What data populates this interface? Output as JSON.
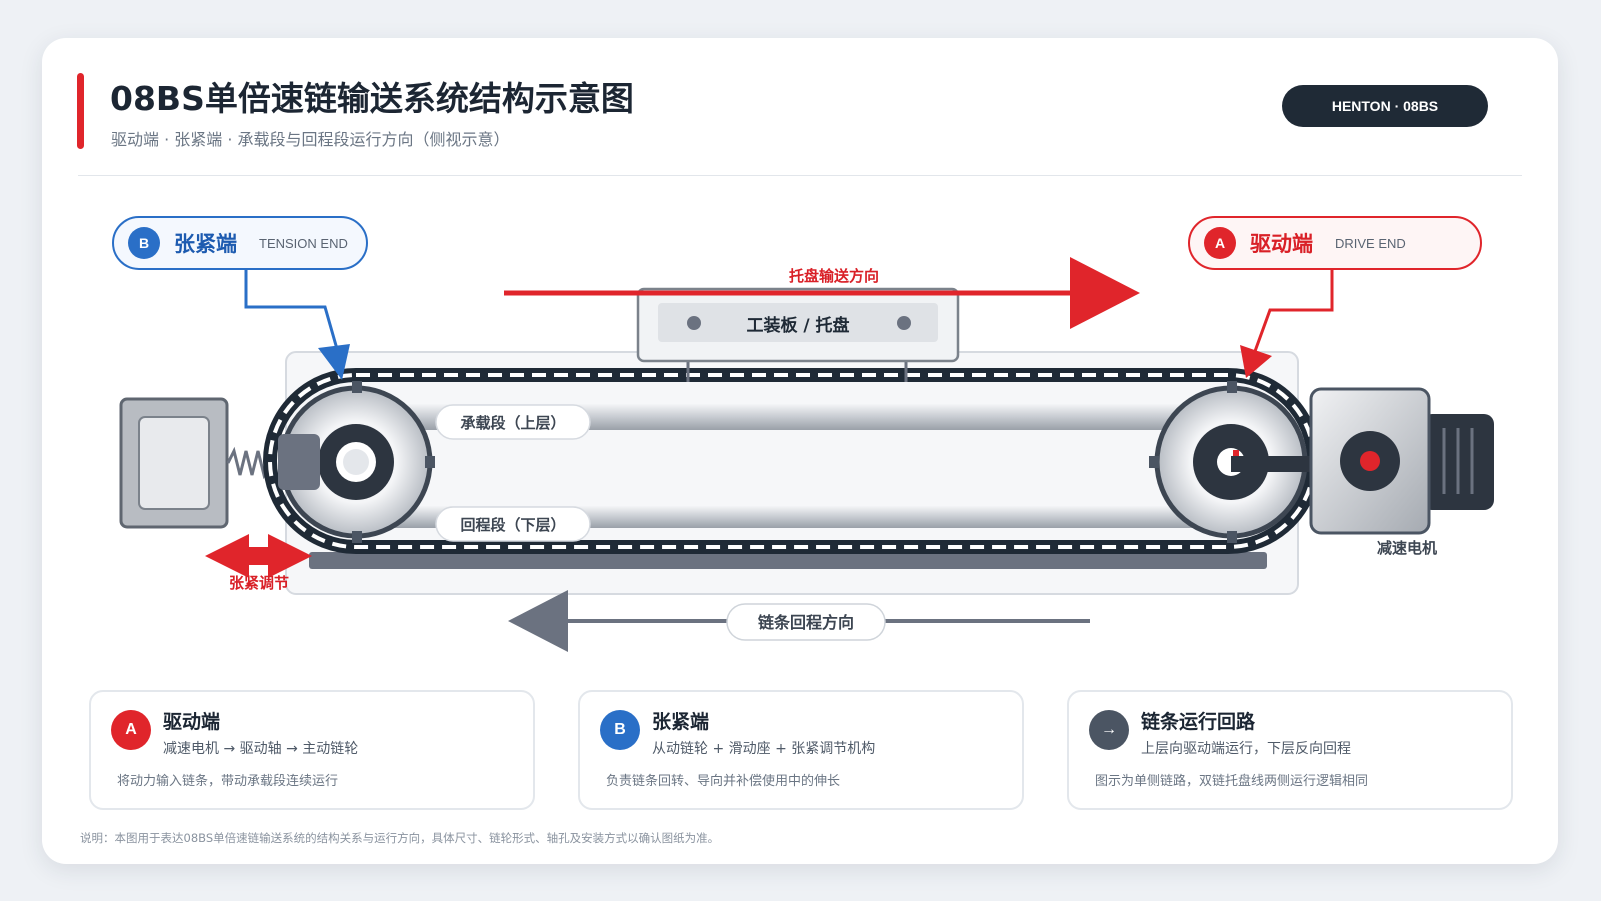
{
  "header": {
    "title": "08BS单倍速链输送系统结构示意图",
    "subtitle": "驱动端 · 张紧端 · 承载段与回程段运行方向（侧视示意）",
    "brand_badge": "HENTON · 08BS"
  },
  "tags": {
    "tension": {
      "badge": "B",
      "name": "张紧端",
      "en": "TENSION END",
      "color": "#2a6fc7"
    },
    "drive": {
      "badge": "A",
      "name": "驱动端",
      "en": "DRIVE END",
      "color": "#e0252b"
    }
  },
  "diagram": {
    "pallet_direction_label": "托盘输送方向",
    "pallet_label": "工装板 / 托盘",
    "upper_segment_label": "承载段（上层）",
    "lower_segment_label": "回程段（下层）",
    "motor_label": "减速电机",
    "tension_adjust_label": "张紧调节",
    "return_direction_label": "链条回程方向"
  },
  "cards": [
    {
      "icon": "A",
      "icon_name": "drive-badge-icon",
      "title": "驱动端",
      "line1": "减速电机 → 驱动轴 → 主动链轮",
      "line2": "将动力输入链条，带动承载段连续运行"
    },
    {
      "icon": "B",
      "icon_name": "tension-badge-icon",
      "title": "张紧端",
      "line1": "从动链轮 + 滑动座 + 张紧调节机构",
      "line2": "负责链条回转、导向并补偿使用中的伸长"
    },
    {
      "icon": "→",
      "icon_name": "arrow-right-icon",
      "title": "链条运行回路",
      "line1": "上层向驱动端运行，下层反向回程",
      "line2": "图示为单侧链路，双链托盘线两侧运行逻辑相同"
    }
  ],
  "footnote": "说明：本图用于表达08BS单倍速链输送系统的结构关系与运行方向，具体尺寸、链轮形式、轴孔及安装方式以确认图纸为准。",
  "colors": {
    "accent_red": "#e0252b",
    "accent_blue": "#2a6fc7",
    "dark": "#1f2a36",
    "steel": "#6b7280"
  }
}
